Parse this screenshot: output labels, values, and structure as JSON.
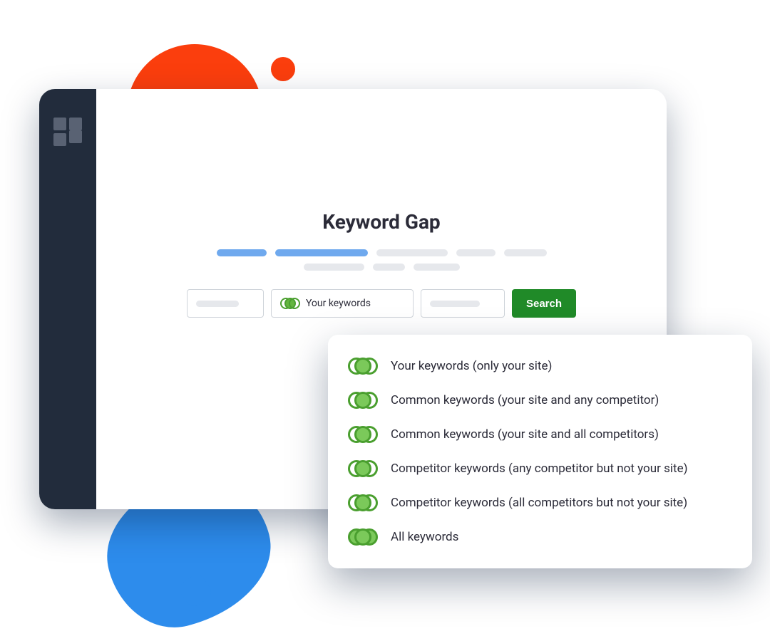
{
  "page": {
    "title": "Keyword Gap"
  },
  "search": {
    "selected_label": "Your keywords",
    "button": "Search"
  },
  "options": [
    {
      "label": "Your keywords (only your site)"
    },
    {
      "label": "Common keywords (your site and any competitor)"
    },
    {
      "label": "Common keywords (your site and all competitors)"
    },
    {
      "label": "Competitor keywords (any competitor but not your site)"
    },
    {
      "label": "Competitor keywords (all competitors but not your site)"
    },
    {
      "label": "All keywords"
    }
  ]
}
